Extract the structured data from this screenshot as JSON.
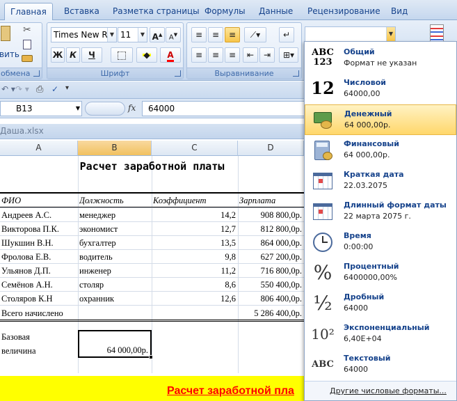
{
  "ribbon": {
    "tabs": [
      "Главная",
      "Вставка",
      "Разметка страницы",
      "Формулы",
      "Данные",
      "Рецензирование",
      "Вид"
    ],
    "paste_label": "вить",
    "clipboard_label": "обмена",
    "font_group_label": "Шрифт",
    "align_group_label": "Выравнивание",
    "font_name": "Times New Rom",
    "font_size": "11",
    "bold_label": "Ж",
    "italic_label": "К",
    "underline_label": "Ч",
    "grow_font_label": "A",
    "shrink_font_label": "A",
    "font_color_label": "A",
    "number_format_value": ""
  },
  "formula_bar": {
    "name_box": "B13",
    "fx_label": "fx",
    "formula": "64000"
  },
  "workbook": {
    "title": "Даша.xlsx"
  },
  "sheet": {
    "columns": [
      "A",
      "B",
      "C",
      "D"
    ],
    "title": "Расчет заработной платы",
    "headers": [
      "ФИО",
      "Должность",
      "Коэффициент",
      "Зарплата"
    ],
    "rows": [
      [
        "Андреев А.С.",
        "менеджер",
        "14,2",
        "908 800,0р."
      ],
      [
        "Викторова П.К.",
        "экономист",
        "12,7",
        "812 800,0р."
      ],
      [
        "Шукшин В.Н.",
        "бухгалтер",
        "13,5",
        "864 000,0р."
      ],
      [
        "Фролова Е.В.",
        "водитель",
        "9,8",
        "627 200,0р."
      ],
      [
        "Ульянов Д.П.",
        "инженер",
        "11,2",
        "716 800,0р."
      ],
      [
        "Семёнов А.Н.",
        "столяр",
        "8,6",
        "550 400,0р."
      ],
      [
        "Столяров К.Н",
        "охранник",
        "12,6",
        "806 400,0р."
      ]
    ],
    "total_label": "Всего начислено",
    "total_value": "5 286 400,0р.",
    "base_label_1": "Базовая",
    "base_label_2": "величина",
    "base_value": "64 000,00р.",
    "bottom_title": "Расчет заработной пла"
  },
  "number_formats": {
    "items": [
      {
        "name": "Общий",
        "sample": "Формат не указан",
        "icon": "general-format-icon",
        "glyph": "ABC\n123"
      },
      {
        "name": "Числовой",
        "sample": "64000,00",
        "icon": "number-format-icon",
        "glyph": "12"
      },
      {
        "name": "Денежный",
        "sample": "64 000,00р.",
        "icon": "currency-format-icon",
        "glyph": ""
      },
      {
        "name": "Финансовый",
        "sample": " 64 000,00р.",
        "icon": "accounting-format-icon",
        "glyph": ""
      },
      {
        "name": "Краткая дата",
        "sample": "22.03.2075",
        "icon": "short-date-icon",
        "glyph": ""
      },
      {
        "name": "Длинный формат даты",
        "sample": "22 марта 2075 г.",
        "icon": "long-date-icon",
        "glyph": ""
      },
      {
        "name": "Время",
        "sample": "0:00:00",
        "icon": "clock-icon",
        "glyph": ""
      },
      {
        "name": "Процентный",
        "sample": "6400000,00%",
        "icon": "percent-icon",
        "glyph": "%"
      },
      {
        "name": "Дробный",
        "sample": "64000",
        "icon": "fraction-icon",
        "glyph": "½"
      },
      {
        "name": "Экспоненциальный",
        "sample": "6,40E+04",
        "icon": "scientific-icon",
        "glyph": "10²"
      },
      {
        "name": "Текстовый",
        "sample": "64000",
        "icon": "text-format-icon",
        "glyph": "ABC"
      }
    ],
    "highlighted_index": 2,
    "more_label": "Другие числовые форматы..."
  },
  "colors": {
    "accent": "#15428b",
    "highlight": "#ffd76b",
    "yellow_banner": "#ffff00",
    "title_red": "#ff0000"
  }
}
